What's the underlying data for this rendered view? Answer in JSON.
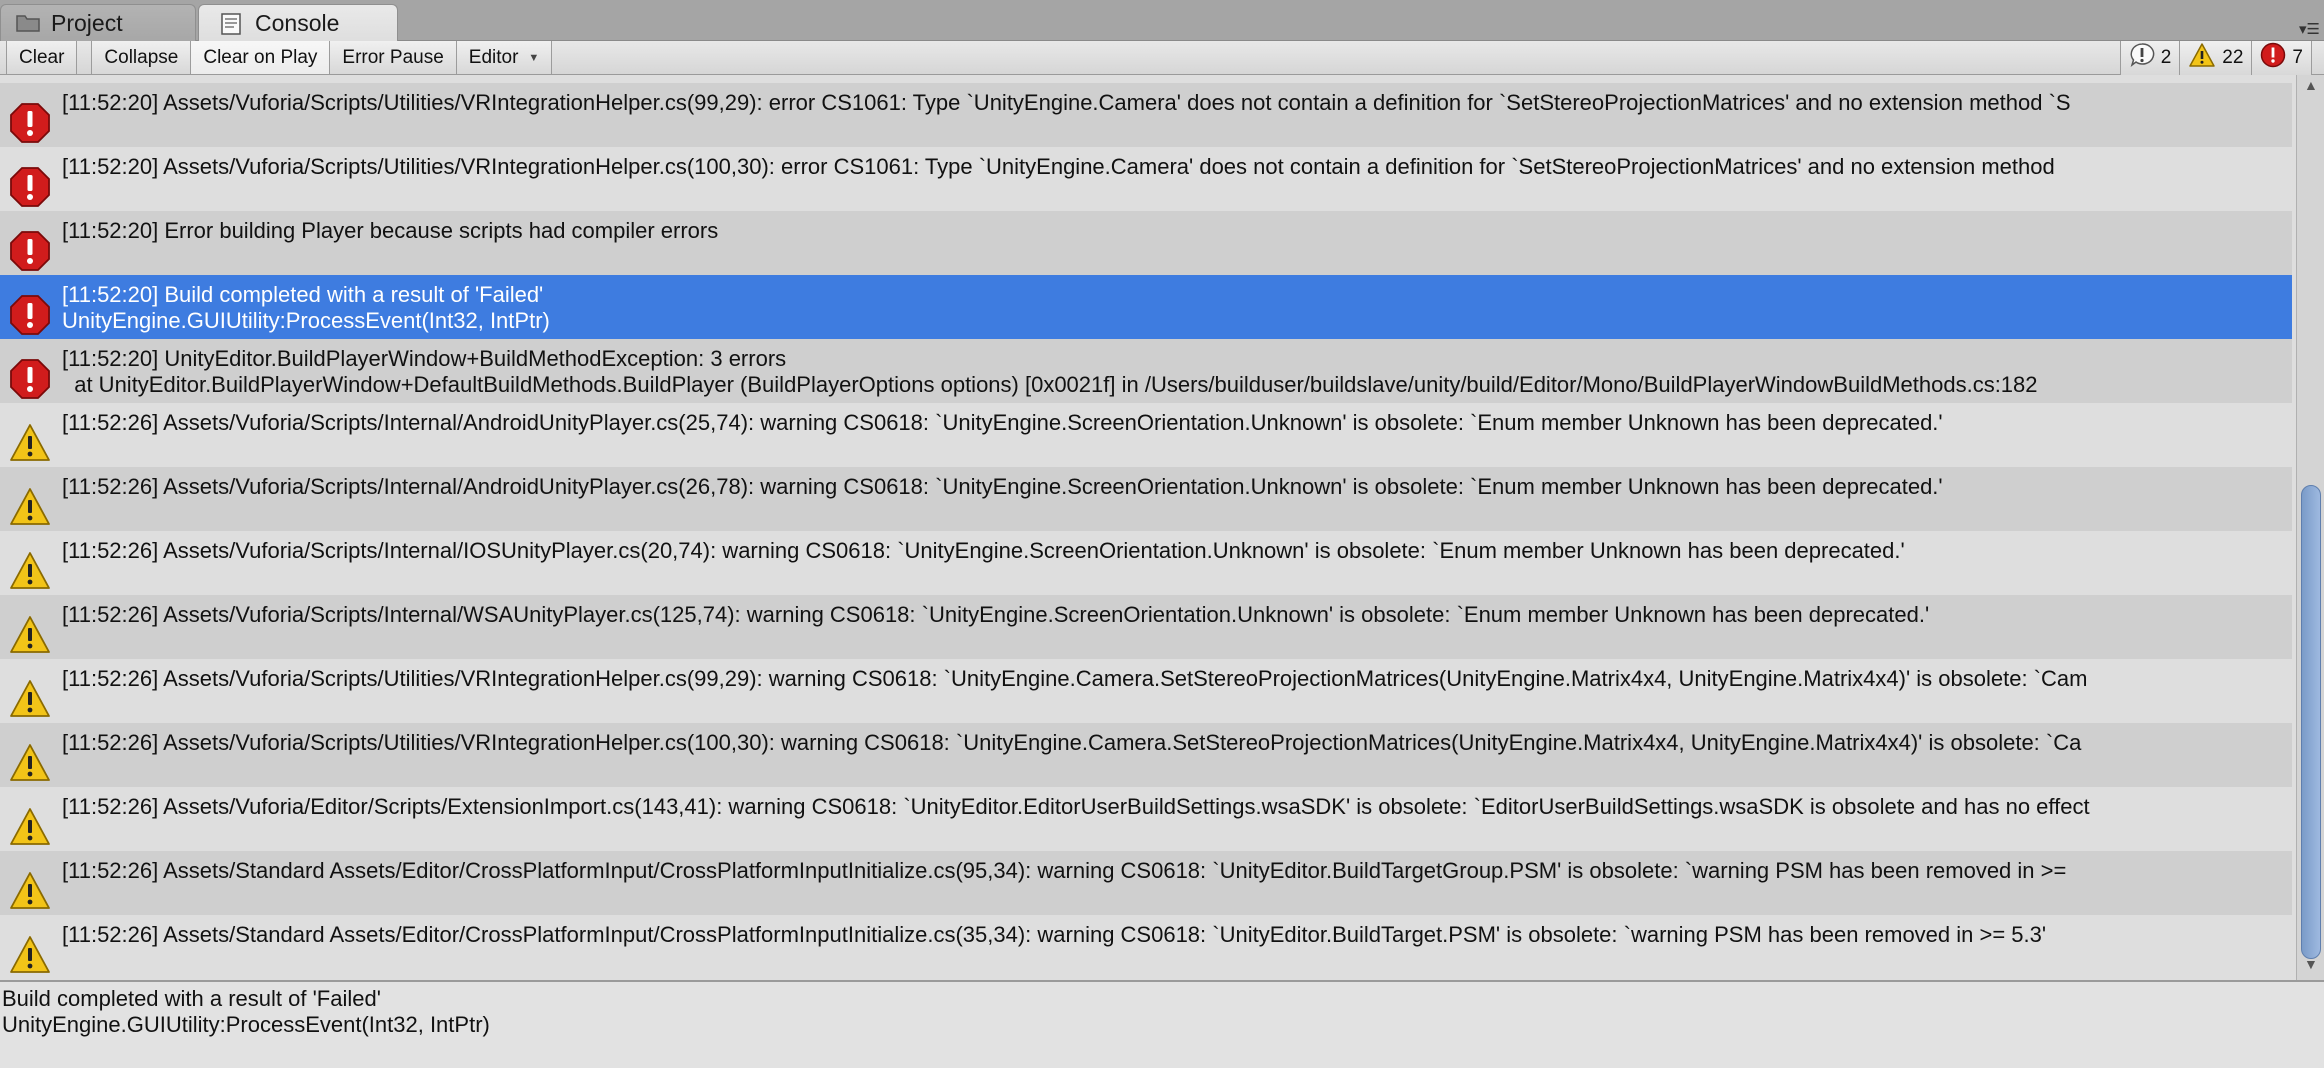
{
  "tabs": [
    {
      "label": "Project",
      "icon": "folder-icon"
    },
    {
      "label": "Console",
      "icon": "console-icon"
    }
  ],
  "toolbar": {
    "clear": "Clear",
    "collapse": "Collapse",
    "clear_on_play": "Clear on Play",
    "error_pause": "Error Pause",
    "editor": "Editor"
  },
  "counters": {
    "info": "2",
    "warning": "22",
    "error": "7"
  },
  "colors": {
    "selection": "#3e7ce0",
    "error_red": "#d11c1c",
    "warning_yellow": "#f2c418"
  },
  "logs": [
    {
      "type": "error",
      "line1": "[11:52:20] Assets/Vuforia/Scripts/Utilities/VRIntegrationHelper.cs(99,29): error CS1061: Type `UnityEngine.Camera' does not contain a definition for `SetStereoProjectionMatrices' and no extension method `S",
      "line2": ""
    },
    {
      "type": "error",
      "line1": "[11:52:20] Assets/Vuforia/Scripts/Utilities/VRIntegrationHelper.cs(100,30): error CS1061: Type `UnityEngine.Camera' does not contain a definition for `SetStereoProjectionMatrices' and no extension method",
      "line2": ""
    },
    {
      "type": "error",
      "line1": "[11:52:20] Error building Player because scripts had compiler errors",
      "line2": ""
    },
    {
      "type": "error",
      "selected": true,
      "line1": "[11:52:20] Build completed with a result of 'Failed'",
      "line2": "UnityEngine.GUIUtility:ProcessEvent(Int32, IntPtr)"
    },
    {
      "type": "error",
      "line1": "[11:52:20] UnityEditor.BuildPlayerWindow+BuildMethodException: 3 errors",
      "line2": "  at UnityEditor.BuildPlayerWindow+DefaultBuildMethods.BuildPlayer (BuildPlayerOptions options) [0x0021f] in /Users/builduser/buildslave/unity/build/Editor/Mono/BuildPlayerWindowBuildMethods.cs:182"
    },
    {
      "type": "warning",
      "line1": "[11:52:26] Assets/Vuforia/Scripts/Internal/AndroidUnityPlayer.cs(25,74): warning CS0618: `UnityEngine.ScreenOrientation.Unknown' is obsolete: `Enum member Unknown has been deprecated.'",
      "line2": ""
    },
    {
      "type": "warning",
      "line1": "[11:52:26] Assets/Vuforia/Scripts/Internal/AndroidUnityPlayer.cs(26,78): warning CS0618: `UnityEngine.ScreenOrientation.Unknown' is obsolete: `Enum member Unknown has been deprecated.'",
      "line2": ""
    },
    {
      "type": "warning",
      "line1": "[11:52:26] Assets/Vuforia/Scripts/Internal/IOSUnityPlayer.cs(20,74): warning CS0618: `UnityEngine.ScreenOrientation.Unknown' is obsolete: `Enum member Unknown has been deprecated.'",
      "line2": ""
    },
    {
      "type": "warning",
      "line1": "[11:52:26] Assets/Vuforia/Scripts/Internal/WSAUnityPlayer.cs(125,74): warning CS0618: `UnityEngine.ScreenOrientation.Unknown' is obsolete: `Enum member Unknown has been deprecated.'",
      "line2": ""
    },
    {
      "type": "warning",
      "line1": "[11:52:26] Assets/Vuforia/Scripts/Utilities/VRIntegrationHelper.cs(99,29): warning CS0618: `UnityEngine.Camera.SetStereoProjectionMatrices(UnityEngine.Matrix4x4, UnityEngine.Matrix4x4)' is obsolete: `Cam",
      "line2": ""
    },
    {
      "type": "warning",
      "line1": "[11:52:26] Assets/Vuforia/Scripts/Utilities/VRIntegrationHelper.cs(100,30): warning CS0618: `UnityEngine.Camera.SetStereoProjectionMatrices(UnityEngine.Matrix4x4, UnityEngine.Matrix4x4)' is obsolete: `Ca",
      "line2": ""
    },
    {
      "type": "warning",
      "line1": "[11:52:26] Assets/Vuforia/Editor/Scripts/ExtensionImport.cs(143,41): warning CS0618: `UnityEditor.EditorUserBuildSettings.wsaSDK' is obsolete: `EditorUserBuildSettings.wsaSDK is obsolete and has no effect",
      "line2": ""
    },
    {
      "type": "warning",
      "line1": "[11:52:26] Assets/Standard Assets/Editor/CrossPlatformInput/CrossPlatformInputInitialize.cs(95,34): warning CS0618: `UnityEditor.BuildTargetGroup.PSM' is obsolete: `warning PSM has been removed in >=",
      "line2": ""
    },
    {
      "type": "warning",
      "line1": "[11:52:26] Assets/Standard Assets/Editor/CrossPlatformInput/CrossPlatformInputInitialize.cs(35,34): warning CS0618: `UnityEditor.BuildTarget.PSM' is obsolete: `warning PSM has been removed in >= 5.3'",
      "line2": ""
    }
  ],
  "detail": {
    "line1": "Build completed with a result of 'Failed'",
    "line2": "UnityEngine.GUIUtility:ProcessEvent(Int32, IntPtr)"
  }
}
